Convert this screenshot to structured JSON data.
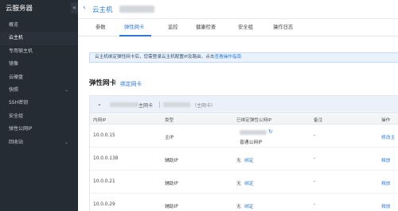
{
  "sidebar": {
    "title": "云服务器",
    "collapse": "«",
    "items": [
      {
        "label": "概览",
        "active": false
      },
      {
        "label": "云主机",
        "active": true
      },
      {
        "label": "专用宿主机",
        "active": false
      },
      {
        "label": "镜像",
        "active": false
      },
      {
        "label": "云硬盘",
        "active": false
      },
      {
        "label": "快照",
        "active": false,
        "chevron": "⌄"
      },
      {
        "label": "SSH密钥",
        "active": false
      },
      {
        "label": "安全组",
        "active": false
      },
      {
        "label": "弹性公网IP",
        "active": false
      },
      {
        "label": "回收站",
        "active": false,
        "chevron": "⌄"
      }
    ]
  },
  "header": {
    "back_icon": "‹",
    "title": "云主机"
  },
  "tabs": [
    {
      "label": "参数"
    },
    {
      "label": "弹性网卡",
      "active": true
    },
    {
      "label": "监控"
    },
    {
      "label": "健康检查"
    },
    {
      "label": "安全组"
    },
    {
      "label": "操作日志"
    }
  ],
  "notice": {
    "text": "云主机绑定弹性网卡后，您需登录云主机配置IP及路由，点击",
    "link": "查看操作指南"
  },
  "section": {
    "title": "弹性网卡",
    "bind_link": "绑定网卡"
  },
  "card": {
    "chevron": "⌄",
    "label": "主网卡",
    "sub": "（主网卡）"
  },
  "table": {
    "headers": [
      "内网IP",
      "类型",
      "已绑定弹性公网IP",
      "备注",
      "操作"
    ],
    "rows": [
      {
        "ip": "10.0.0.15",
        "type": "主IP",
        "eip_suffix": "普通公网IP",
        "remark": "-",
        "op": "修改主"
      },
      {
        "ip": "10.0.0.138",
        "type": "辅助IP",
        "eip": "无",
        "eip_link": "绑定",
        "remark": "-",
        "op": "释放"
      },
      {
        "ip": "10.0.0.21",
        "type": "辅助IP",
        "eip": "无",
        "eip_link": "绑定",
        "remark": "-",
        "op": "释放"
      },
      {
        "ip": "10.0.0.29",
        "type": "辅助IP",
        "eip": "无",
        "eip_link": "绑定",
        "remark": "-",
        "op": "释放"
      }
    ]
  }
}
